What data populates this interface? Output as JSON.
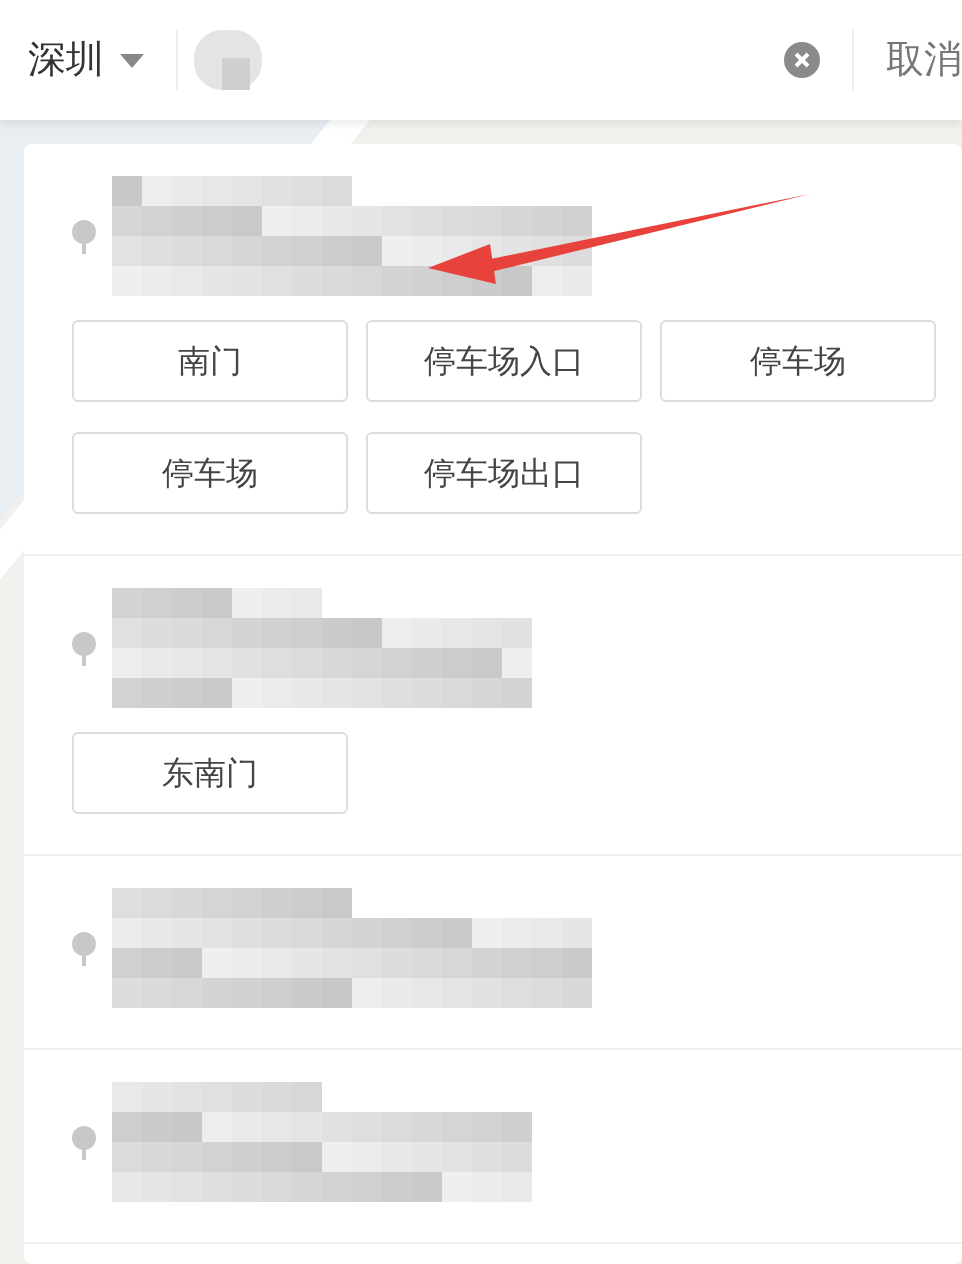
{
  "search_bar": {
    "city": "深圳",
    "cancel": "取消"
  },
  "results": [
    {
      "kind": "with_entrances",
      "entrances": [
        {
          "label": "南门"
        },
        {
          "label": "停车场入口"
        },
        {
          "label": "停车场"
        },
        {
          "label": "停车场"
        },
        {
          "label": "停车场出口"
        }
      ]
    },
    {
      "kind": "with_entrances",
      "entrances": [
        {
          "label": "东南门"
        }
      ]
    },
    {
      "kind": "plain"
    },
    {
      "kind": "plain"
    }
  ],
  "annotation": {
    "kind": "arrow"
  }
}
